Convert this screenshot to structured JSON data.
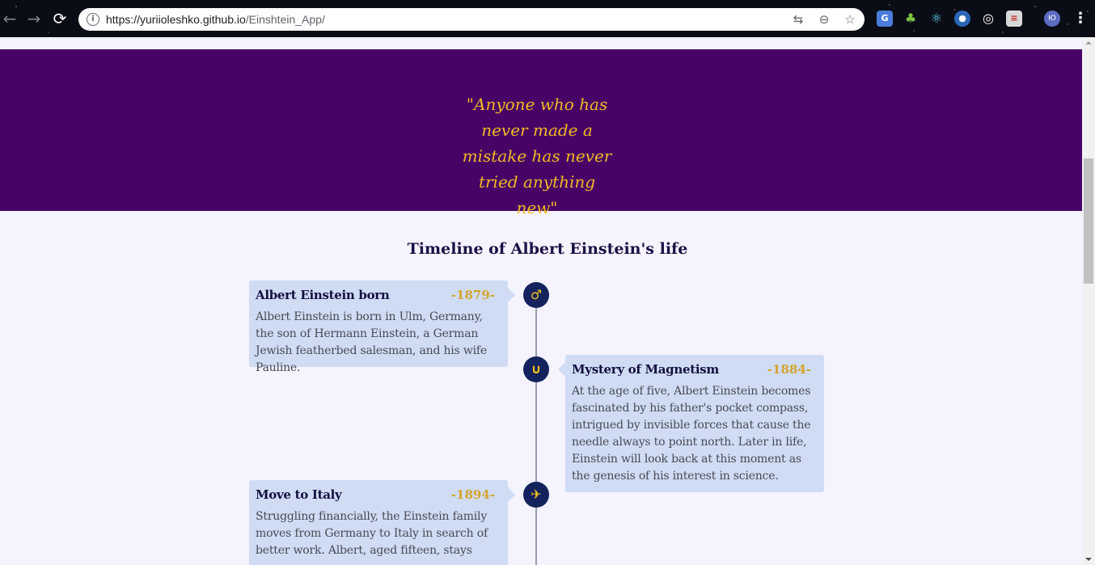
{
  "browser": {
    "url_host": "https://yuriioleshko.github.io",
    "url_path": "/Einshtein_App/",
    "back": "←",
    "forward": "→",
    "reload": "⟳",
    "translate_icon": "⇆",
    "zoom_icon": "⊖",
    "star_icon": "☆",
    "profile_initials": "Ю",
    "menu": "⋮"
  },
  "hero": {
    "quote": "\"Anyone who has never made a mistake has never tried anything new\""
  },
  "timeline": {
    "title": "Timeline of Albert Einstein's life",
    "events": [
      {
        "title": "Albert Einstein born",
        "year": "-1879-",
        "icon": "♂",
        "body": "Albert Einstein is born in Ulm, Germany, the son of Hermann Einstein, a German Jewish featherbed salesman, and his wife Pauline."
      },
      {
        "title": "Mystery of Magnetism",
        "year": "-1884-",
        "icon": "∪",
        "body": "At the age of five, Albert Einstein becomes fascinated by his father's pocket compass, intrigued by invisible forces that cause the needle always to point north. Later in life, Einstein will look back at this moment as the genesis of his interest in science."
      },
      {
        "title": "Move to Italy",
        "year": "-1894-",
        "icon": "✈",
        "body": "Struggling financially, the Einstein family moves from Germany to Italy in search of better work. Albert, aged fifteen, stays"
      }
    ]
  },
  "colors": {
    "hero_bg": "#470466",
    "quote": "#f2b824",
    "card_bg": "#cfdcf4",
    "year": "#d4a42e",
    "node_bg": "#14235e"
  }
}
